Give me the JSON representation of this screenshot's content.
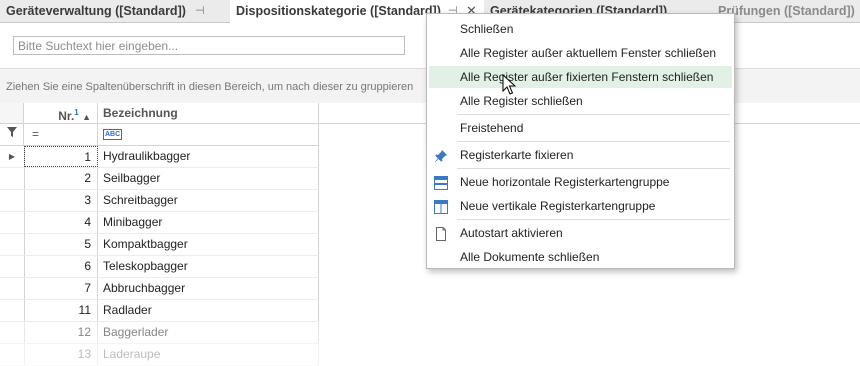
{
  "tabs": [
    {
      "label": "Geräteverwaltung ([Standard])",
      "pin": "⊣"
    },
    {
      "label": "Dispositionskategorie ([Standard])",
      "pin": "⊣",
      "close": "✕"
    },
    {
      "label": "Gerätekategorien ([Standard])"
    },
    {
      "label": "Prüfungen ([Standard])"
    }
  ],
  "search": {
    "placeholder": "Bitte Suchtext hier eingeben..."
  },
  "group_panel": {
    "text": "Ziehen Sie eine Spaltenüberschrift in diesen Bereich, um nach dieser zu gruppieren"
  },
  "grid": {
    "columns": {
      "nr": "Nr.",
      "nr_sort_index": "1",
      "bezeichnung": "Bezeichnung"
    },
    "filter": {
      "nr_operator": "=",
      "bez_type": "ABC"
    },
    "rows": [
      {
        "nr": "1",
        "bezeichnung": "Hydraulikbagger"
      },
      {
        "nr": "2",
        "bezeichnung": "Seilbagger"
      },
      {
        "nr": "3",
        "bezeichnung": "Schreitbagger"
      },
      {
        "nr": "4",
        "bezeichnung": "Minibagger"
      },
      {
        "nr": "5",
        "bezeichnung": "Kompaktbagger"
      },
      {
        "nr": "6",
        "bezeichnung": "Teleskopbagger"
      },
      {
        "nr": "7",
        "bezeichnung": "Abbruchbagger"
      },
      {
        "nr": "11",
        "bezeichnung": "Radlader"
      },
      {
        "nr": "12",
        "bezeichnung": "Baggerlader"
      },
      {
        "nr": "13",
        "bezeichnung": "Laderaupe"
      }
    ]
  },
  "menu": {
    "items": [
      {
        "label": "Schließen"
      },
      {
        "label": "Alle Register außer aktuellem Fenster schließen"
      },
      {
        "label": "Alle Register außer fixierten Fenstern schließen",
        "hover": true
      },
      {
        "label": "Alle Register schließen"
      },
      {
        "label": "Freistehend"
      },
      {
        "label": "Registerkarte fixieren",
        "icon": "pin-icon"
      },
      {
        "label": "Neue horizontale Registerkartengruppe",
        "icon": "horizontal-group-icon"
      },
      {
        "label": "Neue vertikale Registerkartengruppe",
        "icon": "vertical-group-icon"
      },
      {
        "label": "Autostart aktivieren",
        "icon": "document-icon"
      },
      {
        "label": "Alle Dokumente schließen"
      }
    ]
  },
  "colors": {
    "accent": "#2b6cd1",
    "menu_hover": "#e2f1e5"
  }
}
